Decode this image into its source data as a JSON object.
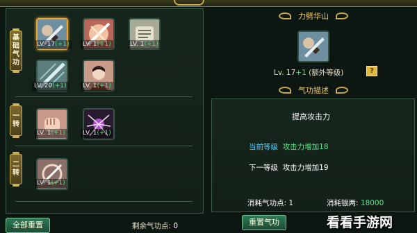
{
  "left_panel": {
    "sections": [
      {
        "label": "基础气功",
        "chars": [
          "基",
          "础",
          "气",
          "功"
        ]
      },
      {
        "label": "一转",
        "chars": [
          "一",
          "转"
        ]
      },
      {
        "label": "二转",
        "chars": [
          "二",
          "转"
        ]
      }
    ],
    "skills": [
      {
        "name": "skill-1",
        "level": "LV. 17",
        "bonus": "(+1)",
        "selected": true,
        "icon": "sword-icon"
      },
      {
        "name": "skill-2",
        "level": "LV. 1",
        "bonus": "(+1)",
        "selected": false,
        "icon": "slash-burst-icon"
      },
      {
        "name": "skill-3",
        "level": "LV. 1",
        "bonus": "(+1)",
        "selected": false,
        "icon": "scroll-icon"
      },
      {
        "name": "skill-4",
        "level": "LV. 20",
        "bonus": "(+1)",
        "selected": false,
        "icon": "blade-strike-icon"
      },
      {
        "name": "skill-5",
        "level": "LV. 1",
        "bonus": "(+1)",
        "selected": false,
        "icon": "warrior-portrait-icon"
      },
      {
        "name": "skill-6",
        "level": "LV. 1",
        "bonus": "(+1)",
        "selected": false,
        "icon": "fist-icon"
      },
      {
        "name": "skill-7",
        "level": "LV. 1",
        "bonus": "(+1)",
        "selected": false,
        "icon": "spider-orb-icon"
      },
      {
        "name": "skill-8",
        "level": "LV. 1",
        "bonus": "(+1)",
        "selected": false,
        "icon": "swirl-blade-icon"
      }
    ],
    "reset_all_label": "全部重置",
    "remaining_label": "剩余气功点",
    "remaining_value": "0"
  },
  "right_panel": {
    "skill_title": "力劈华山",
    "level_text": "Lv. 17",
    "level_bonus": "+1",
    "extra_level_note": "(额外等级)",
    "help_label": "?",
    "desc_section_title": "气功描述",
    "description": "提高攻击力",
    "current_level_label": "当前等级",
    "current_level_value": "攻击力增加18",
    "next_level_label": "下一等级",
    "next_level_value": "攻击力增加19",
    "cost_points_label": "消耗气功点",
    "cost_points_value": "1",
    "cost_silver_label": "消耗银两",
    "cost_silver_value": "18000",
    "reset_skill_label": "重置气功"
  },
  "watermark": "看看手游网",
  "colors": {
    "accent_gold": "#f0c76a",
    "level_plus_green": "#4ee07a",
    "current_level_blue": "#58d0ff",
    "panel_bg": "#17261d"
  }
}
